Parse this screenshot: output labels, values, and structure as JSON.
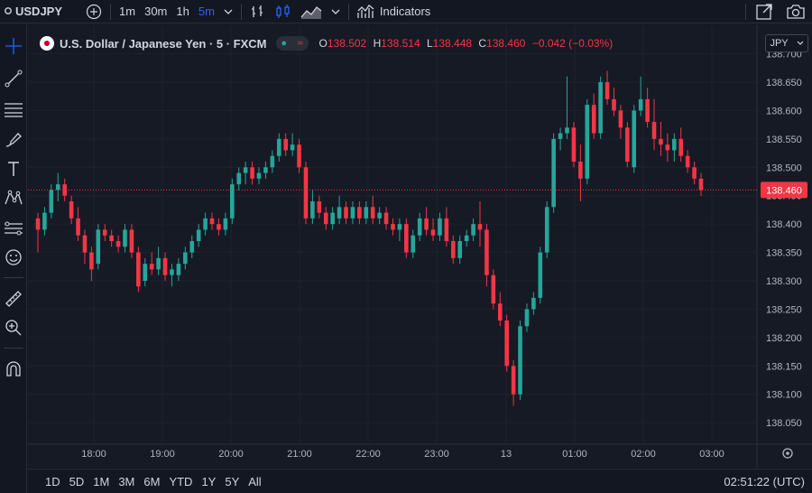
{
  "topbar": {
    "symbol": "USDJPY",
    "intervals": [
      "1m",
      "30m",
      "1h",
      "5m"
    ],
    "active_interval": "5m",
    "indicators_label": "Indicators"
  },
  "legend": {
    "title": "U.S. Dollar / Japanese Yen · 5 · FXCM",
    "open_key": "O",
    "open": "138.502",
    "high_key": "H",
    "high": "138.514",
    "low_key": "L",
    "low": "138.448",
    "close_key": "C",
    "close": "138.460",
    "change": "−0.042 (−0.03%)"
  },
  "currency_select": "JPY",
  "time_labels": [
    "18:00",
    "19:00",
    "20:00",
    "21:00",
    "22:00",
    "23:00",
    "13",
    "01:00",
    "02:00",
    "03:00"
  ],
  "ranges": [
    "1D",
    "5D",
    "1M",
    "3M",
    "6M",
    "YTD",
    "1Y",
    "5Y",
    "All"
  ],
  "clock": "02:51:22 (UTC)",
  "colors": {
    "up": "#26a69a",
    "down": "#f23645",
    "bg": "#161a25",
    "grid": "#1e222d"
  },
  "chart_data": {
    "type": "candlestick",
    "ylim": [
      138.02,
      138.72
    ],
    "price_ticks": [
      "138.700",
      "138.650",
      "138.600",
      "138.550",
      "138.500",
      "138.450",
      "138.400",
      "138.350",
      "138.300",
      "138.250",
      "138.200",
      "138.150",
      "138.100",
      "138.050"
    ],
    "last_price": "138.460",
    "candles": [
      [
        138.41,
        138.42,
        138.35,
        138.39
      ],
      [
        138.39,
        138.43,
        138.38,
        138.42
      ],
      [
        138.42,
        138.47,
        138.41,
        138.46
      ],
      [
        138.46,
        138.49,
        138.44,
        138.47
      ],
      [
        138.47,
        138.48,
        138.44,
        138.45
      ],
      [
        138.44,
        138.45,
        138.4,
        138.41
      ],
      [
        138.41,
        138.43,
        138.37,
        138.38
      ],
      [
        138.38,
        138.39,
        138.33,
        138.35
      ],
      [
        138.35,
        138.36,
        138.3,
        138.32
      ],
      [
        138.33,
        138.4,
        138.32,
        138.39
      ],
      [
        138.39,
        138.4,
        138.37,
        138.38
      ],
      [
        138.38,
        138.39,
        138.36,
        138.37
      ],
      [
        138.37,
        138.38,
        138.35,
        138.36
      ],
      [
        138.36,
        138.4,
        138.35,
        138.39
      ],
      [
        138.39,
        138.4,
        138.34,
        138.35
      ],
      [
        138.35,
        138.36,
        138.28,
        138.29
      ],
      [
        138.3,
        138.34,
        138.29,
        138.33
      ],
      [
        138.33,
        138.35,
        138.31,
        138.32
      ],
      [
        138.32,
        138.36,
        138.31,
        138.34
      ],
      [
        138.34,
        138.35,
        138.3,
        138.31
      ],
      [
        138.31,
        138.33,
        138.29,
        138.32
      ],
      [
        138.31,
        138.34,
        138.3,
        138.33
      ],
      [
        138.33,
        138.36,
        138.32,
        138.35
      ],
      [
        138.35,
        138.38,
        138.34,
        138.37
      ],
      [
        138.37,
        138.4,
        138.36,
        138.39
      ],
      [
        138.39,
        138.42,
        138.38,
        138.41
      ],
      [
        138.41,
        138.42,
        138.39,
        138.4
      ],
      [
        138.4,
        138.41,
        138.38,
        138.39
      ],
      [
        138.39,
        138.42,
        138.38,
        138.41
      ],
      [
        138.41,
        138.48,
        138.4,
        138.47
      ],
      [
        138.47,
        138.5,
        138.46,
        138.49
      ],
      [
        138.49,
        138.51,
        138.47,
        138.5
      ],
      [
        138.5,
        138.51,
        138.47,
        138.48
      ],
      [
        138.48,
        138.5,
        138.47,
        138.49
      ],
      [
        138.49,
        138.51,
        138.48,
        138.5
      ],
      [
        138.5,
        138.53,
        138.49,
        138.52
      ],
      [
        138.52,
        138.56,
        138.51,
        138.55
      ],
      [
        138.55,
        138.56,
        138.52,
        138.53
      ],
      [
        138.53,
        138.56,
        138.52,
        138.54
      ],
      [
        138.54,
        138.55,
        138.49,
        138.5
      ],
      [
        138.5,
        138.51,
        138.4,
        138.41
      ],
      [
        138.41,
        138.46,
        138.4,
        138.44
      ],
      [
        138.44,
        138.45,
        138.41,
        138.42
      ],
      [
        138.42,
        138.43,
        138.39,
        138.4
      ],
      [
        138.4,
        138.43,
        138.39,
        138.42
      ],
      [
        138.41,
        138.45,
        138.4,
        138.43
      ],
      [
        138.43,
        138.44,
        138.4,
        138.41
      ],
      [
        138.41,
        138.44,
        138.4,
        138.43
      ],
      [
        138.43,
        138.44,
        138.4,
        138.41
      ],
      [
        138.41,
        138.44,
        138.4,
        138.43
      ],
      [
        138.43,
        138.45,
        138.4,
        138.41
      ],
      [
        138.41,
        138.43,
        138.4,
        138.42
      ],
      [
        138.42,
        138.43,
        138.39,
        138.4
      ],
      [
        138.4,
        138.41,
        138.38,
        138.39
      ],
      [
        138.39,
        138.41,
        138.37,
        138.4
      ],
      [
        138.4,
        138.41,
        138.34,
        138.35
      ],
      [
        138.35,
        138.39,
        138.34,
        138.38
      ],
      [
        138.38,
        138.42,
        138.37,
        138.41
      ],
      [
        138.41,
        138.43,
        138.38,
        138.39
      ],
      [
        138.39,
        138.41,
        138.37,
        138.38
      ],
      [
        138.38,
        138.42,
        138.37,
        138.41
      ],
      [
        138.41,
        138.43,
        138.36,
        138.37
      ],
      [
        138.37,
        138.38,
        138.33,
        138.34
      ],
      [
        138.34,
        138.38,
        138.33,
        138.37
      ],
      [
        138.37,
        138.39,
        138.36,
        138.38
      ],
      [
        138.38,
        138.41,
        138.37,
        138.4
      ],
      [
        138.4,
        138.44,
        138.36,
        138.39
      ],
      [
        138.39,
        138.4,
        138.29,
        138.31
      ],
      [
        138.31,
        138.32,
        138.25,
        138.26
      ],
      [
        138.26,
        138.28,
        138.22,
        138.23
      ],
      [
        138.23,
        138.24,
        138.14,
        138.15
      ],
      [
        138.15,
        138.16,
        138.08,
        138.1
      ],
      [
        138.1,
        138.23,
        138.09,
        138.22
      ],
      [
        138.22,
        138.26,
        138.21,
        138.25
      ],
      [
        138.25,
        138.28,
        138.24,
        138.27
      ],
      [
        138.27,
        138.36,
        138.26,
        138.35
      ],
      [
        138.35,
        138.44,
        138.34,
        138.43
      ],
      [
        138.43,
        138.56,
        138.42,
        138.55
      ],
      [
        138.55,
        138.57,
        138.53,
        138.56
      ],
      [
        138.56,
        138.66,
        138.55,
        138.57
      ],
      [
        138.57,
        138.58,
        138.5,
        138.51
      ],
      [
        138.51,
        138.54,
        138.44,
        138.48
      ],
      [
        138.48,
        138.62,
        138.47,
        138.61
      ],
      [
        138.61,
        138.63,
        138.55,
        138.56
      ],
      [
        138.56,
        138.66,
        138.55,
        138.65
      ],
      [
        138.65,
        138.67,
        138.61,
        138.62
      ],
      [
        138.62,
        138.64,
        138.59,
        138.6
      ],
      [
        138.6,
        138.61,
        138.55,
        138.57
      ],
      [
        138.57,
        138.58,
        138.5,
        138.51
      ],
      [
        138.5,
        138.61,
        138.49,
        138.6
      ],
      [
        138.6,
        138.66,
        138.59,
        138.62
      ],
      [
        138.62,
        138.64,
        138.57,
        138.58
      ],
      [
        138.58,
        138.62,
        138.53,
        138.55
      ],
      [
        138.55,
        138.58,
        138.52,
        138.54
      ],
      [
        138.54,
        138.56,
        138.51,
        138.53
      ],
      [
        138.53,
        138.56,
        138.51,
        138.55
      ],
      [
        138.55,
        138.57,
        138.51,
        138.52
      ],
      [
        138.52,
        138.53,
        138.49,
        138.5
      ],
      [
        138.5,
        138.51,
        138.47,
        138.48
      ],
      [
        138.48,
        138.49,
        138.45,
        138.46
      ]
    ]
  }
}
